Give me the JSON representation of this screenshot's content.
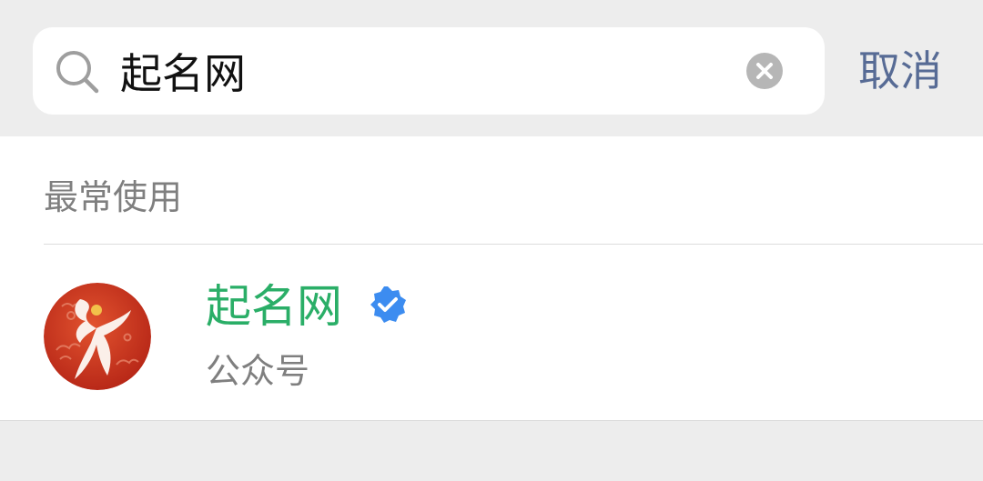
{
  "search": {
    "value": "起名网",
    "cancel_label": "取消"
  },
  "results": {
    "section_title": "最常使用",
    "items": [
      {
        "name": "起名网",
        "type": "公众号",
        "avatar_icon": "qimingwang-logo-icon",
        "verified_icon": "verified-badge-icon"
      }
    ]
  },
  "colors": {
    "accent_link": "#576b95",
    "result_name": "#2aae67",
    "verified": "#3c8cf0",
    "avatar_red": "#c8321e"
  }
}
